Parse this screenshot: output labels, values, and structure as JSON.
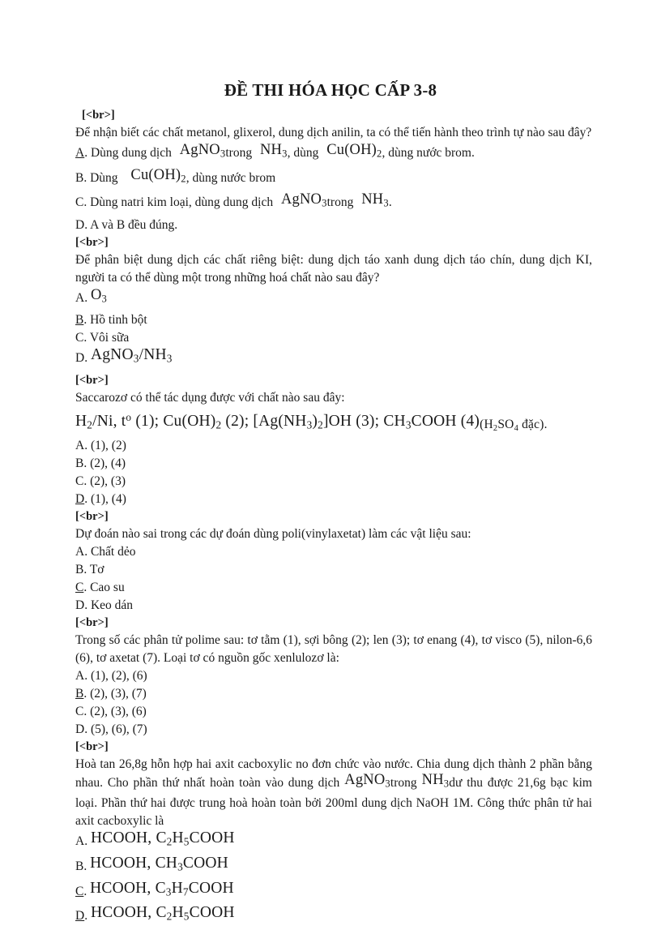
{
  "document": {
    "title": "ĐỀ THI HÓA HỌC CẤP 3-8",
    "br_marker": "[<br>]"
  },
  "questions": [
    {
      "id": "q1",
      "prompt": "Để nhận biết các chất metanol, glixerol,  dung dịch anilin,  ta có thể tiến hành theo trình tự nào sau đây?",
      "options": [
        {
          "letter": "A",
          "is_key": true,
          "pre": "Dùng dung dịch",
          "f1": "AgNO",
          "f1sub": "3",
          "mid1": "trong",
          "f2": "NH",
          "f2sub": "3",
          "mid2": ", dùng",
          "f3": "Cu(OH)",
          "f3sub": "2",
          "post": ", dùng nước brom."
        },
        {
          "letter": "B",
          "is_key": false,
          "pre": "Dùng",
          "f3": "Cu(OH)",
          "f3sub": "2",
          "post": ", dùng nước brom"
        },
        {
          "letter": "C",
          "is_key": false,
          "pre": "Dùng natri kim loại, dùng dung dịch",
          "f1": "AgNO",
          "f1sub": "3",
          "mid1": "trong",
          "f2": "NH",
          "f2sub": "3",
          "post": "."
        },
        {
          "letter": "D",
          "is_key": false,
          "text": "A và B đều đúng."
        }
      ]
    },
    {
      "id": "q2",
      "prompt": "Để phân biệt dung dịch các chất riêng biệt: dung dịch táo xanh dung dịch táo chín, dung dịch KI, người ta có thể dùng một trong những hoá chất nào sau đây?",
      "options": [
        {
          "letter": "A",
          "is_key": false,
          "f1": "O",
          "f1sub": "3"
        },
        {
          "letter": "B",
          "is_key": true,
          "text": "Hồ tinh bột"
        },
        {
          "letter": "C",
          "is_key": false,
          "text": "Vôi sữa"
        },
        {
          "letter": "D",
          "is_key": false,
          "f1": "AgNO",
          "f1sub": "3",
          "slash": "/",
          "f2": "NH",
          "f2sub": "3"
        }
      ]
    },
    {
      "id": "q3",
      "prompt": "Saccarozơ có thể tác dụng được với chất nào sau đây:",
      "formula_line": {
        "p1": "H",
        "p1sub": "2",
        "p2": "/Ni, t",
        "p2sup": "o",
        "p3": " (1); Cu(OH)",
        "p3sub": "2",
        "p4": " (2); [Ag(NH",
        "p4sub": "3",
        "p5": ")",
        "p5sub": "2",
        "p6": "]OH  (3); CH",
        "p6sub": "3",
        "p7": "COOH  (4)",
        "p8": "(H",
        "p8sub": "2",
        "p9": "SO",
        "p9sub": "4",
        "p10": " đặc)."
      },
      "options": [
        {
          "letter": "A",
          "is_key": false,
          "text": "(1), (2)"
        },
        {
          "letter": "B",
          "is_key": false,
          "text": "(2), (4)"
        },
        {
          "letter": "C",
          "is_key": false,
          "text": "(2), (3)"
        },
        {
          "letter": "D",
          "is_key": true,
          "text": "(1), (4)"
        }
      ]
    },
    {
      "id": "q4",
      "prompt": "Dự đoán nào sai trong các dự đoán dùng poli(vinylaxetat)   làm các vật liệu sau:",
      "options": [
        {
          "letter": "A",
          "is_key": false,
          "text": "Chất dẻo"
        },
        {
          "letter": "B",
          "is_key": false,
          "text": "Tơ"
        },
        {
          "letter": "C",
          "is_key": true,
          "text": "Cao su"
        },
        {
          "letter": "D",
          "is_key": false,
          "text": "Keo dán"
        }
      ]
    },
    {
      "id": "q5",
      "prompt": "Trong số các phân tử polime  sau: tơ tằm (1), sợi bông (2); len (3); tơ enang  (4), tơ visco  (5), nilon-6,6  (6), tơ axetat (7). Loại tơ có nguồn  gốc xenlulozơ  là:",
      "options": [
        {
          "letter": "A",
          "is_key": false,
          "text": "(1), (2), (6)"
        },
        {
          "letter": "B",
          "is_key": true,
          "text": "(2), (3), (7)"
        },
        {
          "letter": "C",
          "is_key": false,
          "text": "(2), (3), (6)"
        },
        {
          "letter": "D",
          "is_key": false,
          "text": "(5), (6), (7)"
        }
      ]
    },
    {
      "id": "q6",
      "prompt_part1": "Hoà tan 26,8g hỗn hợp hai axit cacboxylic  no đơn chức vào nước. Chia dung dịch thành 2 phần bằng nhau.  Cho phần thứ nhất hoàn toàn vào dung dịch",
      "prompt_f1": "AgNO",
      "prompt_f1sub": "3",
      "prompt_mid": "trong",
      "prompt_f2": "NH",
      "prompt_f2sub": "3",
      "prompt_part2": "dư thu được 21,6g bạc kim loại. Phần thứ hai được trung hoà hoàn toàn bởi 200ml dung dịch NaOH 1M. Công thức phân tử hai axit cacboxylic  là",
      "options": [
        {
          "letter": "A",
          "is_key": false,
          "a": "HCOOH, C",
          "asub": "2",
          "b": "H",
          "bsub": "5",
          "c": "COOH"
        },
        {
          "letter": "B",
          "is_key": false,
          "a": "HCOOH, CH",
          "asub": "3",
          "b": "",
          "bsub": "",
          "c": "COOH"
        },
        {
          "letter": "C",
          "is_key": true,
          "a": "HCOOH, C",
          "asub": "3",
          "b": "H",
          "bsub": "7",
          "c": "COOH"
        },
        {
          "letter": "D",
          "is_key": false,
          "a": "HCOOH, C",
          "asub": "2",
          "b": "H",
          "bsub": "5",
          "c": "COOH"
        }
      ]
    }
  ]
}
